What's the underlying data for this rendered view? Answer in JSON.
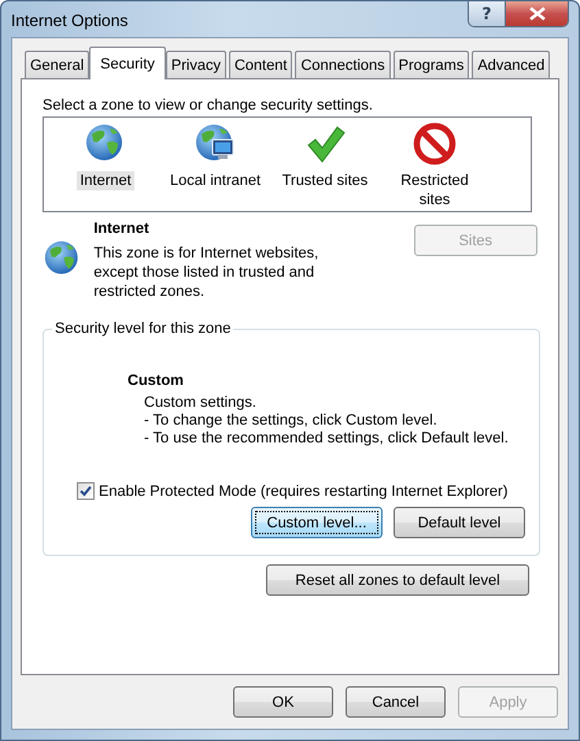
{
  "window": {
    "title": "Internet Options",
    "help_button": "?"
  },
  "tabs": [
    {
      "label": "General",
      "selected": false
    },
    {
      "label": "Security",
      "selected": true
    },
    {
      "label": "Privacy",
      "selected": false
    },
    {
      "label": "Content",
      "selected": false
    },
    {
      "label": "Connections",
      "selected": false
    },
    {
      "label": "Programs",
      "selected": false
    },
    {
      "label": "Advanced",
      "selected": false
    }
  ],
  "zones": {
    "prompt": "Select a zone to view or change security settings.",
    "items": [
      {
        "kind": "internet",
        "label": "Internet",
        "selected": true
      },
      {
        "kind": "intranet",
        "label": "Local intranet",
        "selected": false
      },
      {
        "kind": "trusted",
        "label": "Trusted sites",
        "selected": false
      },
      {
        "kind": "restricted",
        "label": "Restricted sites",
        "selected": false
      }
    ]
  },
  "zone_info": {
    "kind": "internet",
    "title": "Internet",
    "description": "This zone is for Internet websites, except those listed in trusted and restricted zones.",
    "sites_button": {
      "label": "Sites",
      "disabled": true
    }
  },
  "security_level": {
    "legend": "Security level for this zone",
    "level_name": "Custom",
    "description": [
      "Custom settings.",
      "- To change the settings, click Custom level.",
      "- To use the recommended settings, click Default level."
    ],
    "protected_mode": {
      "label": "Enable Protected Mode (requires restarting Internet Explorer)",
      "checked": true
    },
    "buttons": [
      {
        "label": "Custom level...",
        "focused": true
      },
      {
        "label": "Default level",
        "focused": false
      }
    ]
  },
  "reset_button": "Reset all zones to default level",
  "footer_buttons": [
    {
      "label": "OK",
      "disabled": false
    },
    {
      "label": "Cancel",
      "disabled": false
    },
    {
      "label": "Apply",
      "disabled": true
    }
  ]
}
